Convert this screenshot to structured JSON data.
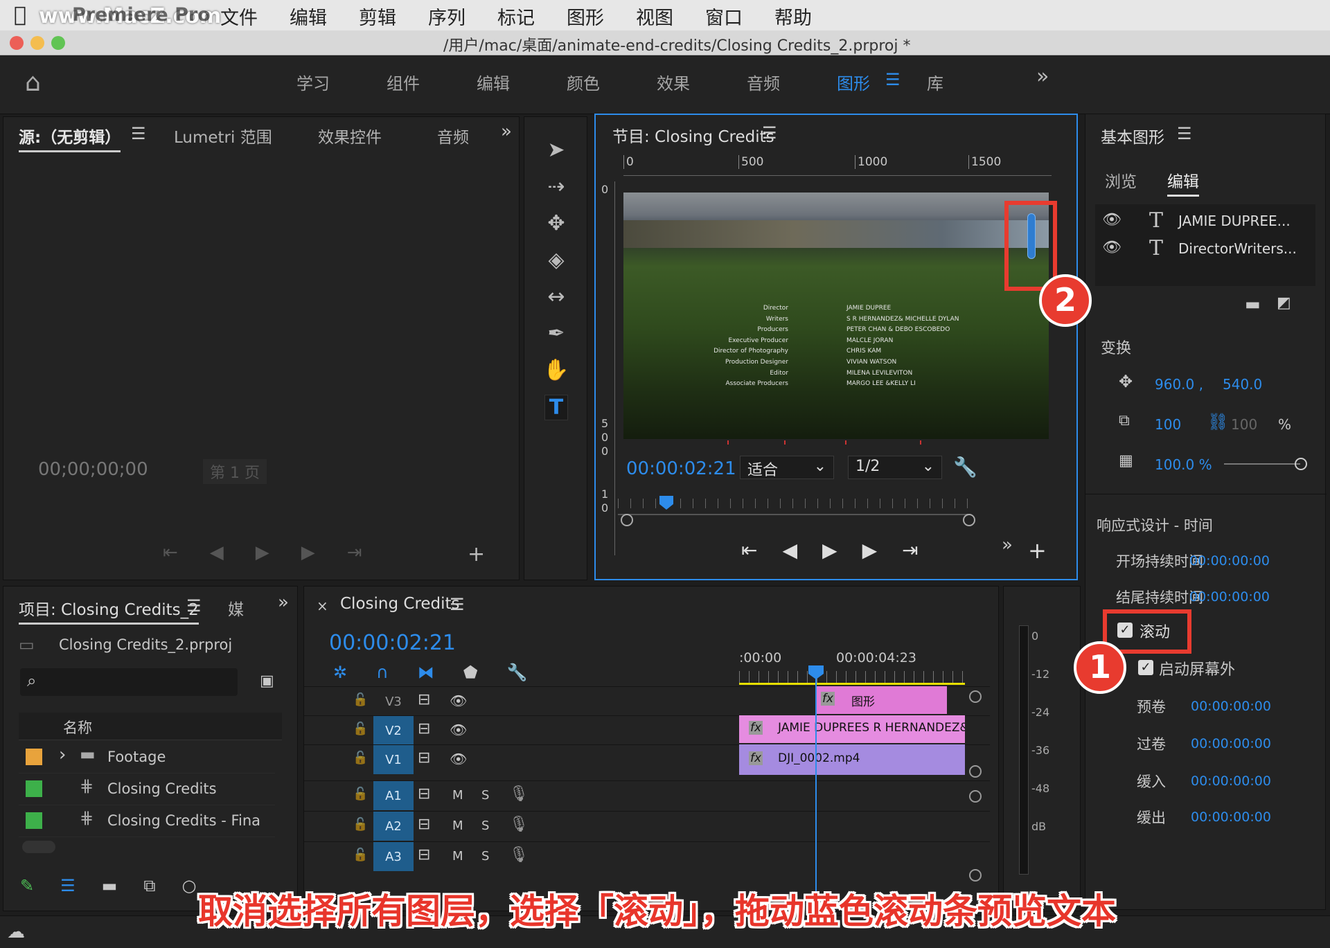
{
  "menubar": {
    "watermark": "www.MacZ.com",
    "app": "Premiere Pro",
    "items": [
      "文件",
      "编辑",
      "剪辑",
      "序列",
      "标记",
      "图形",
      "视图",
      "窗口",
      "帮助"
    ]
  },
  "window": {
    "title": "/用户/mac/桌面/animate-end-credits/Closing Credits_2.prproj *"
  },
  "workspaces": {
    "items": [
      "学习",
      "组件",
      "编辑",
      "颜色",
      "效果",
      "音频",
      "图形",
      "库"
    ],
    "active": "图形",
    "more": "»"
  },
  "source": {
    "tabs": [
      "源:（无剪辑）",
      "Lumetri 范围",
      "效果控件",
      "音频"
    ],
    "timecode": "00;00;00;00",
    "page": "第 1 页"
  },
  "program": {
    "title": "节目: Closing Credits",
    "timecode": "00:00:02:21",
    "fit": "适合",
    "quality": "1/2",
    "ruler_h": [
      "0",
      "500",
      "1000",
      "1500"
    ],
    "ruler_v": [
      "0",
      "5",
      "0",
      "0",
      "1",
      "0"
    ],
    "credits": [
      {
        "role": "Director",
        "name": "JAMIE DUPREE"
      },
      {
        "role": "Writers",
        "name": "S R HERNANDEZ& MICHELLE DYLAN"
      },
      {
        "role": "Producers",
        "name": "PETER CHAN & DEBO ESCOBEDO"
      },
      {
        "role": "Executive Producer",
        "name": "MALCLE JORAN"
      },
      {
        "role": "Director of Photography",
        "name": "CHRIS KAM"
      },
      {
        "role": "Production Designer",
        "name": "VIVIAN WATSON"
      },
      {
        "role": "Editor",
        "name": "MILENA LEVILEVITON"
      },
      {
        "role": "Associate Producers",
        "name": "MARGO LEE &KELLY LI"
      }
    ],
    "scroll_progress": 0.1
  },
  "eg": {
    "title": "基本图形",
    "tabs": [
      "浏览",
      "编辑"
    ],
    "active_tab": "编辑",
    "layers": [
      "JAMIE DUPREE...",
      "DirectorWriters..."
    ],
    "transform_label": "变换",
    "pos_x": "960.0 ,",
    "pos_y": "540.0",
    "scale": "100",
    "scale2": "100",
    "pct": "%",
    "opacity": "100.0 %",
    "responsive_label": "响应式设计 - 时间",
    "intro_label": "开场持续时间",
    "intro_val": "00:00:00:00",
    "outro_label": "结尾持续时间",
    "outro_val": "00:00:00:00",
    "roll_label": "滚动",
    "offscreen_label": "启动屏幕外",
    "preroll_label": "预卷",
    "preroll_val": "00:00:00:00",
    "postroll_label": "过卷",
    "postroll_val": "00:00:00:00",
    "easein_label": "缓入",
    "easein_val": "00:00:00:00",
    "easeout_label": "缓出",
    "easeout_val": "00:00:00:00"
  },
  "project": {
    "title": "项目: Closing Credits_2",
    "tab2": "媒",
    "file": "Closing Credits_2.prproj",
    "col": "名称",
    "items": [
      {
        "name": "Footage",
        "color": "#e8a33c"
      },
      {
        "name": "Closing Credits",
        "color": "#3db04a"
      },
      {
        "name": "Closing Credits - Fina",
        "color": "#3db04a"
      }
    ]
  },
  "timeline": {
    "title": "Closing Credits",
    "timecode": "00:00:02:21",
    "ruler": [
      ":00:00",
      "00:00:04:23"
    ],
    "tracks": [
      "V3",
      "V2",
      "V1",
      "A1",
      "A2",
      "A3"
    ],
    "m": "M",
    "s": "S",
    "clips": {
      "v3": "图形",
      "v2": "JAMIE DUPREES R HERNANDEZ&",
      "v1": "DJI_0002.mp4"
    },
    "playhead": 0.35
  },
  "meter": {
    "labels": [
      "0",
      "-12",
      "-24",
      "-36",
      "-48",
      "dB"
    ]
  },
  "annot": {
    "caption": "取消选择所有图层，选择「滚动」，拖动蓝色滚动条预览文本",
    "n1": "1",
    "n2": "2"
  },
  "colors": {
    "accent": "#2d8ceb",
    "annot_red": "#e83b2f",
    "v3clip": "#e07ad6",
    "v2clip": "#e58ce0",
    "v1clip": "#a58be0"
  }
}
